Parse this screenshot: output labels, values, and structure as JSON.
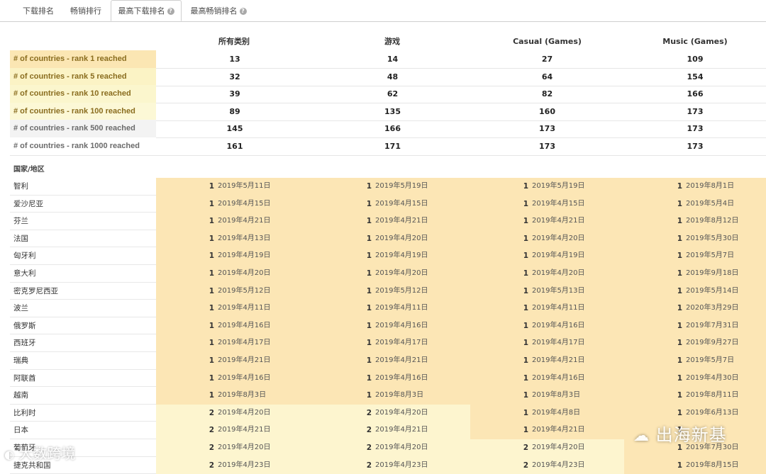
{
  "tabs": [
    {
      "label": "下载排名",
      "active": false,
      "help": false
    },
    {
      "label": "畅销排行",
      "active": false,
      "help": false
    },
    {
      "label": "最高下载排名",
      "active": true,
      "help": true
    },
    {
      "label": "最高畅销排名",
      "active": false,
      "help": true
    }
  ],
  "columns": [
    "所有类别",
    "游戏",
    "Casual (Games)",
    "Music (Games)"
  ],
  "summary": [
    {
      "label": "# of countries - rank 1 reached",
      "values": [
        "13",
        "14",
        "27",
        "109"
      ],
      "color": "#fbe6b3"
    },
    {
      "label": "# of countries - rank 5 reached",
      "values": [
        "32",
        "48",
        "64",
        "154"
      ],
      "color": "#fbf3c5"
    },
    {
      "label": "# of countries - rank 10 reached",
      "values": [
        "39",
        "62",
        "82",
        "166"
      ],
      "color": "#fbf6cd"
    },
    {
      "label": "# of countries - rank 100 reached",
      "values": [
        "89",
        "135",
        "160",
        "173"
      ],
      "color": "#fcf8d6"
    },
    {
      "label": "# of countries - rank 500 reached",
      "values": [
        "145",
        "166",
        "173",
        "173"
      ],
      "color": "#f3f3f3"
    },
    {
      "label": "# of countries - rank 1000 reached",
      "values": [
        "161",
        "171",
        "173",
        "173"
      ],
      "color": "#ffffff"
    }
  ],
  "section_title": "国家/地区",
  "countries": [
    {
      "name": "智利",
      "cells": [
        {
          "rank": "1",
          "date": "2019年5月11日"
        },
        {
          "rank": "1",
          "date": "2019年5月19日"
        },
        {
          "rank": "1",
          "date": "2019年5月19日"
        },
        {
          "rank": "1",
          "date": "2019年8月1日"
        }
      ]
    },
    {
      "name": "爱沙尼亚",
      "cells": [
        {
          "rank": "1",
          "date": "2019年4月15日"
        },
        {
          "rank": "1",
          "date": "2019年4月15日"
        },
        {
          "rank": "1",
          "date": "2019年4月15日"
        },
        {
          "rank": "1",
          "date": "2019年5月4日"
        }
      ]
    },
    {
      "name": "芬兰",
      "cells": [
        {
          "rank": "1",
          "date": "2019年4月21日"
        },
        {
          "rank": "1",
          "date": "2019年4月21日"
        },
        {
          "rank": "1",
          "date": "2019年4月21日"
        },
        {
          "rank": "1",
          "date": "2019年8月12日"
        }
      ]
    },
    {
      "name": "法国",
      "cells": [
        {
          "rank": "1",
          "date": "2019年4月13日"
        },
        {
          "rank": "1",
          "date": "2019年4月20日"
        },
        {
          "rank": "1",
          "date": "2019年4月20日"
        },
        {
          "rank": "1",
          "date": "2019年5月30日"
        }
      ]
    },
    {
      "name": "匈牙利",
      "cells": [
        {
          "rank": "1",
          "date": "2019年4月19日"
        },
        {
          "rank": "1",
          "date": "2019年4月19日"
        },
        {
          "rank": "1",
          "date": "2019年4月19日"
        },
        {
          "rank": "1",
          "date": "2019年5月7日"
        }
      ]
    },
    {
      "name": "意大利",
      "cells": [
        {
          "rank": "1",
          "date": "2019年4月20日"
        },
        {
          "rank": "1",
          "date": "2019年4月20日"
        },
        {
          "rank": "1",
          "date": "2019年4月20日"
        },
        {
          "rank": "1",
          "date": "2019年9月18日"
        }
      ]
    },
    {
      "name": "密克罗尼西亚",
      "cells": [
        {
          "rank": "1",
          "date": "2019年5月12日"
        },
        {
          "rank": "1",
          "date": "2019年5月12日"
        },
        {
          "rank": "1",
          "date": "2019年5月13日"
        },
        {
          "rank": "1",
          "date": "2019年5月14日"
        }
      ]
    },
    {
      "name": "波兰",
      "cells": [
        {
          "rank": "1",
          "date": "2019年4月11日"
        },
        {
          "rank": "1",
          "date": "2019年4月11日"
        },
        {
          "rank": "1",
          "date": "2019年4月11日"
        },
        {
          "rank": "1",
          "date": "2020年3月29日"
        }
      ]
    },
    {
      "name": "俄罗斯",
      "cells": [
        {
          "rank": "1",
          "date": "2019年4月16日"
        },
        {
          "rank": "1",
          "date": "2019年4月16日"
        },
        {
          "rank": "1",
          "date": "2019年4月16日"
        },
        {
          "rank": "1",
          "date": "2019年7月31日"
        }
      ]
    },
    {
      "name": "西班牙",
      "cells": [
        {
          "rank": "1",
          "date": "2019年4月17日"
        },
        {
          "rank": "1",
          "date": "2019年4月17日"
        },
        {
          "rank": "1",
          "date": "2019年4月17日"
        },
        {
          "rank": "1",
          "date": "2019年9月27日"
        }
      ]
    },
    {
      "name": "瑞典",
      "cells": [
        {
          "rank": "1",
          "date": "2019年4月21日"
        },
        {
          "rank": "1",
          "date": "2019年4月21日"
        },
        {
          "rank": "1",
          "date": "2019年4月21日"
        },
        {
          "rank": "1",
          "date": "2019年5月7日"
        }
      ]
    },
    {
      "name": "阿联酋",
      "cells": [
        {
          "rank": "1",
          "date": "2019年4月16日"
        },
        {
          "rank": "1",
          "date": "2019年4月16日"
        },
        {
          "rank": "1",
          "date": "2019年4月16日"
        },
        {
          "rank": "1",
          "date": "2019年4月30日"
        }
      ]
    },
    {
      "name": "越南",
      "cells": [
        {
          "rank": "1",
          "date": "2019年8月3日"
        },
        {
          "rank": "1",
          "date": "2019年8月3日"
        },
        {
          "rank": "1",
          "date": "2019年8月3日"
        },
        {
          "rank": "1",
          "date": "2019年8月11日"
        }
      ]
    },
    {
      "name": "比利时",
      "cells": [
        {
          "rank": "2",
          "date": "2019年4月20日"
        },
        {
          "rank": "2",
          "date": "2019年4月20日"
        },
        {
          "rank": "1",
          "date": "2019年4月8日"
        },
        {
          "rank": "1",
          "date": "2019年6月13日"
        }
      ]
    },
    {
      "name": "日本",
      "cells": [
        {
          "rank": "2",
          "date": "2019年4月21日"
        },
        {
          "rank": "2",
          "date": "2019年4月21日"
        },
        {
          "rank": "1",
          "date": "2019年4月21日"
        },
        {
          "rank": "1",
          "date": ""
        }
      ]
    },
    {
      "name": "葡萄牙",
      "cells": [
        {
          "rank": "2",
          "date": "2019年4月20日"
        },
        {
          "rank": "2",
          "date": "2019年4月20日"
        },
        {
          "rank": "2",
          "date": "2019年4月20日"
        },
        {
          "rank": "1",
          "date": "2019年7月30日"
        }
      ]
    },
    {
      "name": "捷克共和国",
      "cells": [
        {
          "rank": "2",
          "date": "2019年4月23日"
        },
        {
          "rank": "2",
          "date": "2019年4月23日"
        },
        {
          "rank": "2",
          "date": "2019年4月23日"
        },
        {
          "rank": "1",
          "date": "2019年8月15日"
        }
      ]
    }
  ],
  "rank_colors": {
    "1": "#fce6b5",
    "2": "#fdf5cf"
  },
  "watermarks": {
    "left": "大数跨境",
    "right": "出海新基"
  }
}
